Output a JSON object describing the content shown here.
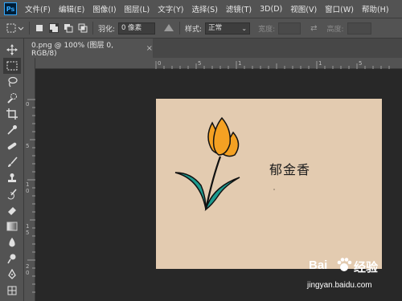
{
  "app": {
    "logo": "Ps"
  },
  "menu": [
    "文件(F)",
    "编辑(E)",
    "图像(I)",
    "图层(L)",
    "文字(Y)",
    "选择(S)",
    "滤镜(T)",
    "3D(D)",
    "视图(V)",
    "窗口(W)",
    "帮助(H)"
  ],
  "options": {
    "feather_label": "羽化:",
    "feather_value": "0 像素",
    "style_label": "样式:",
    "style_value": "正常",
    "width_label": "宽度:",
    "height_label": "高度:"
  },
  "document": {
    "tab_title": "0.png @ 100% (图层 0, RGB/8)",
    "close_glyph": "×"
  },
  "ruler": {
    "top_ticks": [
      "0",
      "5",
      "1",
      "1",
      "5"
    ],
    "left_ticks": [
      "0",
      "5",
      "1",
      "0",
      "1",
      "5",
      "2",
      "0"
    ]
  },
  "canvas": {
    "title": "郁金香",
    "background": "#e3cbb0",
    "petal_color": "#f4a123",
    "leaf_color": "#1d9b8f"
  },
  "watermark": {
    "brand_left": "Bai",
    "brand_right": "经验",
    "url": "jingyan.baidu.com"
  }
}
